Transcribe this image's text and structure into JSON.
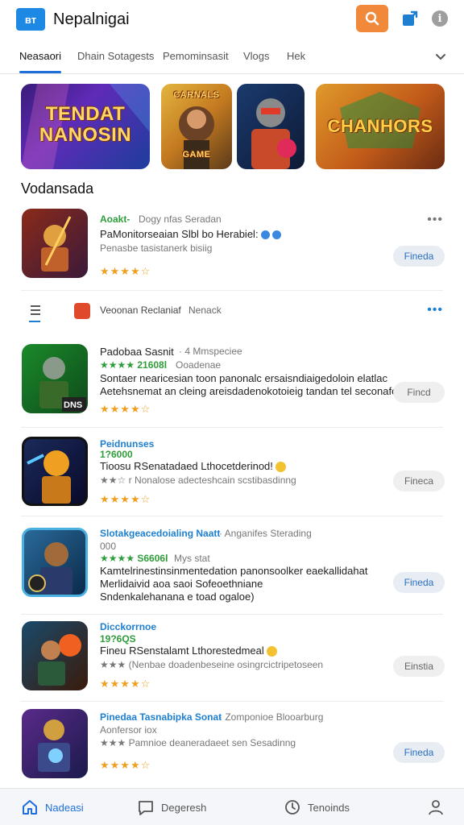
{
  "header": {
    "logo_text": "вт",
    "title": "Nepalnigai",
    "icons": [
      "search-icon",
      "share-icon",
      "info-icon"
    ],
    "info_glyph": "i"
  },
  "tabs": [
    {
      "label": "Neasaori",
      "active": true
    },
    {
      "label": "Dhain Sotagests",
      "active": false
    },
    {
      "label": "Pemominsasit",
      "active": false
    },
    {
      "label": "Vlogs",
      "active": false
    },
    {
      "label": "Hek",
      "active": false
    }
  ],
  "banners": [
    {
      "line1": "TENDAT",
      "line2": "NANOSIN"
    },
    {
      "line1": "CARNALS",
      "line2": "GAME"
    },
    {
      "line1": "",
      "line2": ""
    },
    {
      "line1": "CHANHORS",
      "line2": ""
    }
  ],
  "section": {
    "title": "Vodansada"
  },
  "filter": {
    "label": "Veoonan Reclaniaf",
    "label2": "Nenack"
  },
  "items": [
    {
      "line1_green": "Aoakt-",
      "line1_gray": "Dogy nfas Seradan",
      "line2": "PaMonitorseaian Slbl bo Herabiel:",
      "line3": "Penasbe tasistanerk bisiig",
      "stars": "★★★★☆",
      "action": "Fineda",
      "menu": "•••"
    },
    {
      "line1": "Padobaa Sasnit",
      "line1_gray": "· 4 Mmspeciee",
      "line2_green": "★★★★ 21608l",
      "line2_gray": "Ooadenae",
      "line3": "Sontaer nearicesian toon panonalc ersaisndiaigedoloin elatlac",
      "line4": "Aetehsnemat an cleing areisdadenokotoieig tandan tel seconafost.",
      "stars": "★★★★☆",
      "action": "Fincd",
      "badge": "DNS"
    },
    {
      "line1_blue": "Peidnunses",
      "line2_green": "1?6000",
      "line3": "Tioosu RSenatadaed Lthocetderinod!",
      "line4": "★★☆ r Nonalose adecteshcain scstibasdinng",
      "stars": "★★★★☆",
      "action": "Fineca"
    },
    {
      "line1_blue": "Slotakgeacedoialing Naatt",
      "line1_gray": "· Anganifes Sterading",
      "line2": "000",
      "line3_green": "★★★★ S6606l",
      "line3_gray": "Mys stat",
      "line4": "Kamtelrinestinsinmentedation panonsoolker eaekallidahat",
      "line5": "Merlidaivid aoa saoi Sofeoethniane",
      "line6": "Sndenkalehanana e toad ogaloe)",
      "stars": "",
      "action": "Fineda"
    },
    {
      "line1_blue": "Dicckorrnoe",
      "line2_green": "19?6QS",
      "line3": "Fineu RSenstalamt Lthorestedmeal",
      "line4": "★★★ (Nenbae doadenbeseine osingrcictripetoseen",
      "stars": "★★★★☆",
      "action": "Einstia"
    },
    {
      "line1_blue": "Pinedaa Tasnabipka Sonat",
      "line1_gray": "· Zomponioe Blooarburg",
      "line2": "Aonfersor iox",
      "line3": "★★★ Pamnioe deaneradaeet sen Sesadinng",
      "stars": "★★★★☆",
      "action": "Fineda"
    }
  ],
  "bottom_nav": [
    {
      "label": "Nadeasi",
      "icon": "home-icon",
      "active": true
    },
    {
      "label": "Degeresh",
      "icon": "chat-icon",
      "active": false
    },
    {
      "label": "Tenoinds",
      "icon": "clock-icon",
      "active": false
    },
    {
      "label": "",
      "icon": "profile-icon",
      "active": false
    }
  ]
}
